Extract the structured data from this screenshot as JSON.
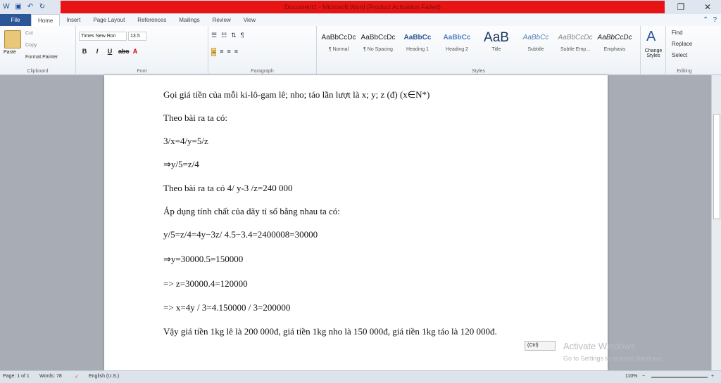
{
  "title": "Document1 - Microsoft Word (Product Activation Failed)",
  "tabs": [
    "File",
    "Home",
    "Insert",
    "Page Layout",
    "References",
    "Mailings",
    "Review",
    "View"
  ],
  "clipboard": {
    "paste": "Paste",
    "cut": "Cut",
    "copy": "Copy",
    "painter": "Format Painter",
    "label": "Clipboard"
  },
  "font": {
    "name": "Times New Ron",
    "size": "13.5",
    "label": "Font"
  },
  "paragraph_label": "Paragraph",
  "styles": [
    {
      "sample": "AaBbCcDc",
      "name": "¶ Normal"
    },
    {
      "sample": "AaBbCcDc",
      "name": "¶ No Spacing"
    },
    {
      "sample": "AaBbCc",
      "name": "Heading 1"
    },
    {
      "sample": "AaBbCc",
      "name": "Heading 2"
    },
    {
      "sample": "AaB",
      "name": "Title"
    },
    {
      "sample": "AaBbCc",
      "name": "Subtitle"
    },
    {
      "sample": "AaBbCcDc",
      "name": "Subtle Emp..."
    },
    {
      "sample": "AaBbCcDc",
      "name": "Emphasis"
    }
  ],
  "styles_label": "Styles",
  "change_styles": "Change Styles",
  "editing": {
    "find": "Find",
    "replace": "Replace",
    "select": "Select",
    "label": "Editing"
  },
  "doc_lines": [
    "Gọi giá tiền của mỗi ki-lô-gam lê; nho; táo lần lượt là x; y; z (đ) (x∈N*)",
    "Theo bài ra ta có:",
    "3/x=4/y=5/z",
    "⇒y/5=z/4",
    "Theo bài ra ta có 4/ y-3 /z=240 000",
    "Áp dụng tính chất của dãy tỉ số bằng nhau ta có:",
    "y/5=z/4=4y−3z/ 4.5−3.4=2400008=30000",
    "⇒y=30000.5=150000",
    "=> z=30000.4=120000",
    "=> x=4y / 3=4.150000 / 3=200000",
    "Vậy giá tiền 1kg lê là 200 000đ, giá tiền 1kg nho là 150 000đ, giá tiền 1kg táo là 120 000đ."
  ],
  "paste_ctl": "(Ctrl)",
  "watermark": {
    "line1": "Activate Windows",
    "line2": "Go to Settings to activate Windows."
  },
  "status": {
    "page": "Page: 1 of 1",
    "words": "Words: 78",
    "lang": "English (U.S.)",
    "zoom": "110%"
  }
}
